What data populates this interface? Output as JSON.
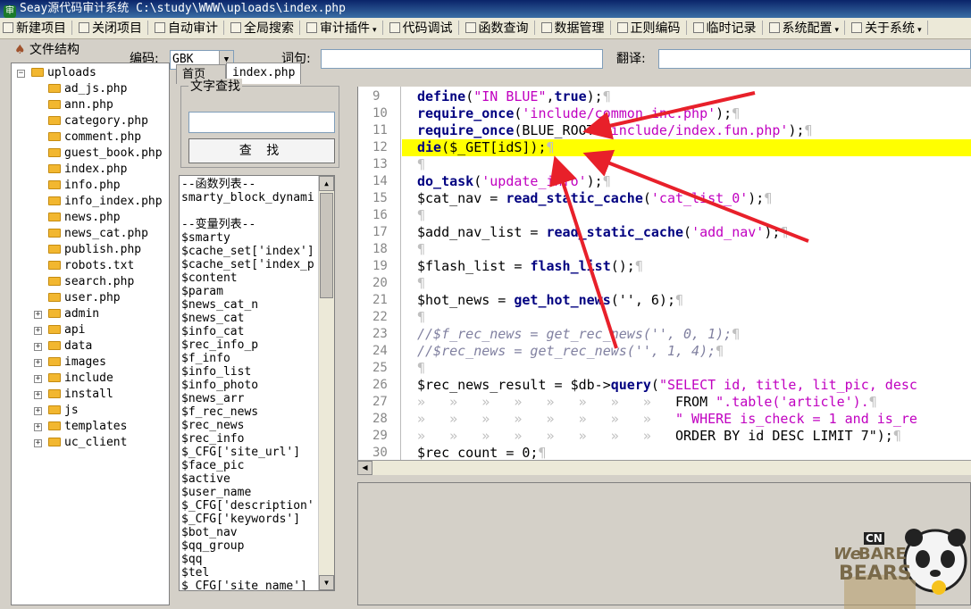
{
  "window": {
    "title": "Seay源代码审计系统  C:\\study\\WWW\\uploads\\index.php"
  },
  "menu": [
    {
      "label": "新建项目",
      "icon": "new-project-icon"
    },
    {
      "label": "关闭项目",
      "icon": "close-project-icon"
    },
    {
      "label": "自动审计",
      "icon": "auto-audit-icon"
    },
    {
      "label": "全局搜索",
      "icon": "global-search-icon"
    },
    {
      "label": "审计插件",
      "icon": "plugin-icon"
    },
    {
      "label": "代码调试",
      "icon": "debug-icon"
    },
    {
      "label": "函数查询",
      "icon": "function-query-icon"
    },
    {
      "label": "数据管理",
      "icon": "data-manage-icon"
    },
    {
      "label": "正则编码",
      "icon": "regex-encode-icon"
    },
    {
      "label": "临时记录",
      "icon": "temp-record-icon"
    },
    {
      "label": "系统配置",
      "icon": "settings-icon"
    },
    {
      "label": "关于系统",
      "icon": "about-icon"
    }
  ],
  "toolbar": {
    "file_structure": "文件结构",
    "encoding_label": "编码:",
    "encoding_value": "GBK",
    "phrase_label": "词句:",
    "phrase_value": "",
    "translate_label": "翻译:",
    "translate_value": ""
  },
  "tree": {
    "root": "uploads",
    "files": [
      "ad_js.php",
      "ann.php",
      "category.php",
      "comment.php",
      "guest_book.php",
      "index.php",
      "info.php",
      "info_index.php",
      "news.php",
      "news_cat.php",
      "publish.php",
      "robots.txt",
      "search.php",
      "user.php"
    ],
    "folders": [
      "admin",
      "api",
      "data",
      "images",
      "include",
      "install",
      "js",
      "templates",
      "uc_client"
    ]
  },
  "tabs": [
    "首页",
    "index.php"
  ],
  "find": {
    "group_label": "文字查找",
    "input_value": "",
    "button_label": "查 找"
  },
  "varlist": [
    "--函数列表--",
    "smarty_block_dynami",
    "",
    "--变量列表--",
    "$smarty",
    "$cache_set['index']",
    "$cache_set['index_p",
    "$content",
    "$param",
    "$news_cat_n",
    "$news_cat",
    "$info_cat",
    "$rec_info_p",
    "$f_info",
    "$info_list",
    "$info_photo",
    "$news_arr",
    "$f_rec_news",
    "$rec_news",
    "$rec_info",
    "$_CFG['site_url']",
    "$face_pic",
    "$active",
    "$user_name",
    "$_CFG['description'",
    "$_CFG['keywords']",
    "$bot_nav",
    "$qq_group",
    "$qq",
    "$tel",
    "$_CFG['site_name']"
  ],
  "editor": {
    "highlight_line": 12,
    "lines": [
      {
        "n": "9",
        "code": [
          [
            "kw",
            "define"
          ],
          [
            "",
            "("
          ],
          [
            "st",
            "\"IN BLUE\""
          ],
          [
            "",
            ","
          ],
          [
            "kw",
            "true"
          ],
          [
            "",
            ");"
          ],
          [
            "pl",
            "¶"
          ]
        ]
      },
      {
        "n": "10",
        "code": [
          [
            "kw",
            "require_once"
          ],
          [
            "",
            "("
          ],
          [
            "st",
            "'include/common.inc.php'"
          ],
          [
            "",
            ");"
          ],
          [
            "pl",
            "¶"
          ]
        ]
      },
      {
        "n": "11",
        "code": [
          [
            "kw",
            "require_once"
          ],
          [
            "",
            "(BLUE_ROOT."
          ],
          [
            "st",
            "'include/index.fun.php'"
          ],
          [
            "",
            ");"
          ],
          [
            "pl",
            "¶"
          ]
        ]
      },
      {
        "n": "12",
        "code": [
          [
            "kw",
            "die"
          ],
          [
            "",
            "($_GET[idS]);"
          ],
          [
            "pl",
            "¶"
          ]
        ]
      },
      {
        "n": "13",
        "code": [
          [
            "pl",
            "¶"
          ]
        ]
      },
      {
        "n": "14",
        "code": [
          [
            "kw",
            "do_task"
          ],
          [
            "",
            "("
          ],
          [
            "st",
            "'update_info'"
          ],
          [
            "",
            ");"
          ],
          [
            "pl",
            "¶"
          ]
        ]
      },
      {
        "n": "15",
        "code": [
          [
            "",
            "$cat_nav = "
          ],
          [
            "kw",
            "read_static_cache"
          ],
          [
            "",
            "("
          ],
          [
            "st",
            "'cat_list_0'"
          ],
          [
            "",
            ");"
          ],
          [
            "pl",
            "¶"
          ]
        ]
      },
      {
        "n": "16",
        "code": [
          [
            "pl",
            "¶"
          ]
        ]
      },
      {
        "n": "17",
        "code": [
          [
            "",
            "$add_nav_list = "
          ],
          [
            "kw",
            "read_static_cache"
          ],
          [
            "",
            "("
          ],
          [
            "st",
            "'add_nav'"
          ],
          [
            "",
            ");"
          ],
          [
            "pl",
            "¶"
          ]
        ]
      },
      {
        "n": "18",
        "code": [
          [
            "pl",
            "¶"
          ]
        ]
      },
      {
        "n": "19",
        "code": [
          [
            "",
            "$flash_list = "
          ],
          [
            "kw",
            "flash_list"
          ],
          [
            "",
            "();"
          ],
          [
            "pl",
            "¶"
          ]
        ]
      },
      {
        "n": "20",
        "code": [
          [
            "pl",
            "¶"
          ]
        ]
      },
      {
        "n": "21",
        "code": [
          [
            "",
            "$hot_news = "
          ],
          [
            "kw",
            "get_hot_news"
          ],
          [
            "",
            "('', 6);"
          ],
          [
            "pl",
            "¶"
          ]
        ]
      },
      {
        "n": "22",
        "code": [
          [
            "pl",
            "¶"
          ]
        ]
      },
      {
        "n": "23",
        "code": [
          [
            "cm",
            "//$f_rec_news = get_rec_news('', 0, 1);"
          ],
          [
            "pl",
            "¶"
          ]
        ]
      },
      {
        "n": "24",
        "code": [
          [
            "cm",
            "//$rec_news = get_rec_news('', 1, 4);"
          ],
          [
            "pl",
            "¶"
          ]
        ]
      },
      {
        "n": "25",
        "code": [
          [
            "pl",
            "¶"
          ]
        ]
      },
      {
        "n": "26",
        "code": [
          [
            "",
            "$rec_news_result = $db->"
          ],
          [
            "kw",
            "query"
          ],
          [
            "",
            "("
          ],
          [
            "st",
            "\"SELECT id, title, lit_pic, desc"
          ]
        ]
      },
      {
        "n": "27",
        "code": [
          [
            "pl",
            "»   »   »   »   »   »   »   »   "
          ],
          [
            "",
            "FROM "
          ],
          [
            "st",
            "\".table('article')."
          ],
          [
            "pl",
            "¶"
          ]
        ]
      },
      {
        "n": "28",
        "code": [
          [
            "pl",
            "»   »   »   »   »   »   »   »   "
          ],
          [
            "st",
            "\" WHERE is_check = 1 and is_re"
          ]
        ]
      },
      {
        "n": "29",
        "code": [
          [
            "pl",
            "»   »   »   »   »   »   »   »   "
          ],
          [
            "",
            "ORDER BY id DESC LIMIT 7\");"
          ],
          [
            "pl",
            "¶"
          ]
        ]
      },
      {
        "n": "30",
        "code": [
          [
            "",
            "$rec_count = 0;"
          ],
          [
            "pl",
            "¶"
          ]
        ]
      }
    ]
  },
  "sticker": {
    "text_brand": "CN",
    "text_we": "We",
    "text_bare": "BARE",
    "text_bears": "BEARS"
  },
  "colors": {
    "highlight": "#ffff00",
    "keyword": "#000080",
    "string": "#c000c0",
    "arrow": "#e8202a"
  }
}
